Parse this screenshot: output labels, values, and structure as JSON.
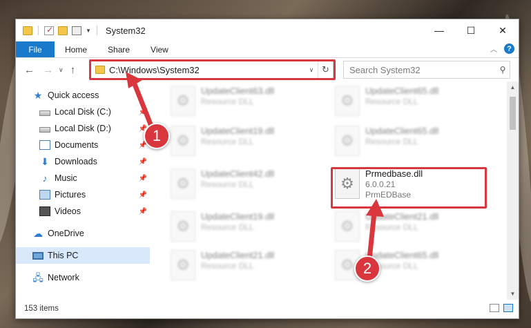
{
  "window": {
    "title": "System32",
    "controls": {
      "minimize": "—",
      "maximize": "☐",
      "close": "✕"
    }
  },
  "ribbon": {
    "file_tab": "File",
    "tabs": [
      "Home",
      "Share",
      "View"
    ],
    "help": "?"
  },
  "nav": {
    "address": "C:\\Windows\\System32",
    "search_placeholder": "Search System32"
  },
  "sidebar": {
    "items": [
      {
        "label": "Quick access",
        "icon": "star-icon",
        "pinned": false
      },
      {
        "label": "Local Disk (C:)",
        "icon": "drive-icon",
        "pinned": true
      },
      {
        "label": "Local Disk (D:)",
        "icon": "drive-icon",
        "pinned": true
      },
      {
        "label": "Documents",
        "icon": "documents-icon",
        "pinned": true
      },
      {
        "label": "Downloads",
        "icon": "download-icon",
        "pinned": true
      },
      {
        "label": "Music",
        "icon": "music-icon",
        "pinned": true
      },
      {
        "label": "Pictures",
        "icon": "pictures-icon",
        "pinned": true
      },
      {
        "label": "Videos",
        "icon": "videos-icon",
        "pinned": true
      },
      {
        "label": "OneDrive",
        "icon": "cloud-icon",
        "pinned": false
      },
      {
        "label": "This PC",
        "icon": "computer-icon",
        "pinned": false,
        "selected": true
      },
      {
        "label": "Network",
        "icon": "network-icon",
        "pinned": false
      }
    ]
  },
  "files": [
    {
      "name": "UpdateClient63.dll",
      "type": "Resource DLL",
      "blurred": true
    },
    {
      "name": "UpdateClient65.dll",
      "type": "Resource DLL",
      "blurred": true
    },
    {
      "name": "UpdateClient19.dll",
      "type": "Resource DLL",
      "blurred": true
    },
    {
      "name": "UpdateClient65.dll",
      "type": "Resource DLL",
      "blurred": true
    },
    {
      "name": "UpdateClient42.dll",
      "type": "Resource DLL",
      "blurred": true
    },
    {
      "name": "Prmedbase.dll",
      "version": "6.0.0.21",
      "type": "PrmEDBase",
      "blurred": false,
      "highlighted": true
    },
    {
      "name": "UpdateClient19.dll",
      "type": "Resource DLL",
      "blurred": true
    },
    {
      "name": "UpdateClient21.dll",
      "type": "Resource DLL",
      "blurred": true
    },
    {
      "name": "UpdateClient21.dll",
      "type": "Resource DLL",
      "blurred": true
    },
    {
      "name": "UpdateClient65.dll",
      "type": "Resource DLL",
      "blurred": true
    }
  ],
  "status": {
    "item_count": "153 items"
  },
  "annotations": {
    "step1": "1",
    "step2": "2",
    "accent_color": "#d9363e"
  }
}
